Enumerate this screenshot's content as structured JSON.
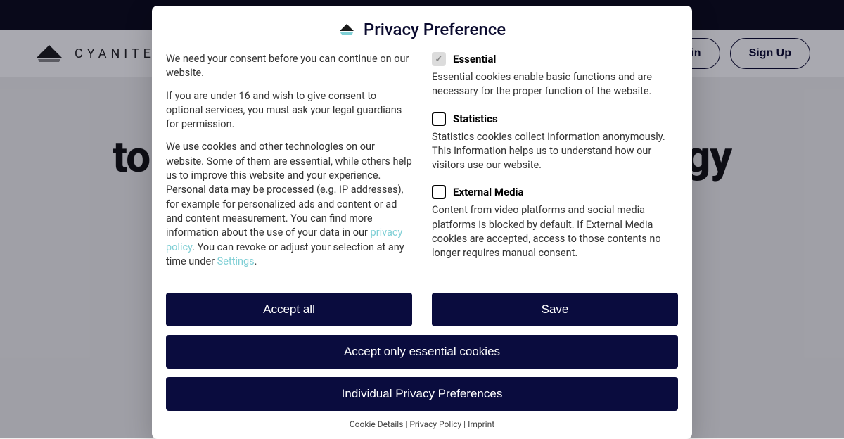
{
  "header": {
    "brand": "CYANITE",
    "login": "Login",
    "signup": "Sign Up"
  },
  "hero": {
    "headline": "to take your distribution strategy"
  },
  "modal": {
    "title": "Privacy Preference",
    "intro1": "We need your consent before you can continue on our website.",
    "intro2": "If you are under 16 and wish to give consent to optional services, you must ask your legal guardians for permission.",
    "intro3a": "We use cookies and other technologies on our website. Some of them are essential, while others help us to improve this website and your experience. Personal data may be processed (e.g. IP addresses), for example for personalized ads and content or ad and content measurement. You can find more information about the use of your data in our ",
    "privacy_link": "privacy policy",
    "intro3b": ". You can revoke or adjust your selection at any time under ",
    "settings_link": "Settings",
    "intro3c": ".",
    "categories": [
      {
        "title": "Essential",
        "desc": "Essential cookies enable basic functions and are necessary for the proper function of the website.",
        "checked": true,
        "locked": true
      },
      {
        "title": "Statistics",
        "desc": "Statistics cookies collect information anonymously. This information helps us to understand how our visitors use our website.",
        "checked": false,
        "locked": false
      },
      {
        "title": "External Media",
        "desc": "Content from video platforms and social media platforms is blocked by default. If External Media cookies are accepted, access to those contents no longer requires manual consent.",
        "checked": false,
        "locked": false
      }
    ],
    "buttons": {
      "accept_all": "Accept all",
      "save": "Save",
      "essential_only": "Accept only essential cookies",
      "individual": "Individual Privacy Preferences"
    },
    "footer": {
      "cookie_details": "Cookie Details",
      "privacy_policy": "Privacy Policy",
      "imprint": "Imprint",
      "sep": " | "
    }
  }
}
